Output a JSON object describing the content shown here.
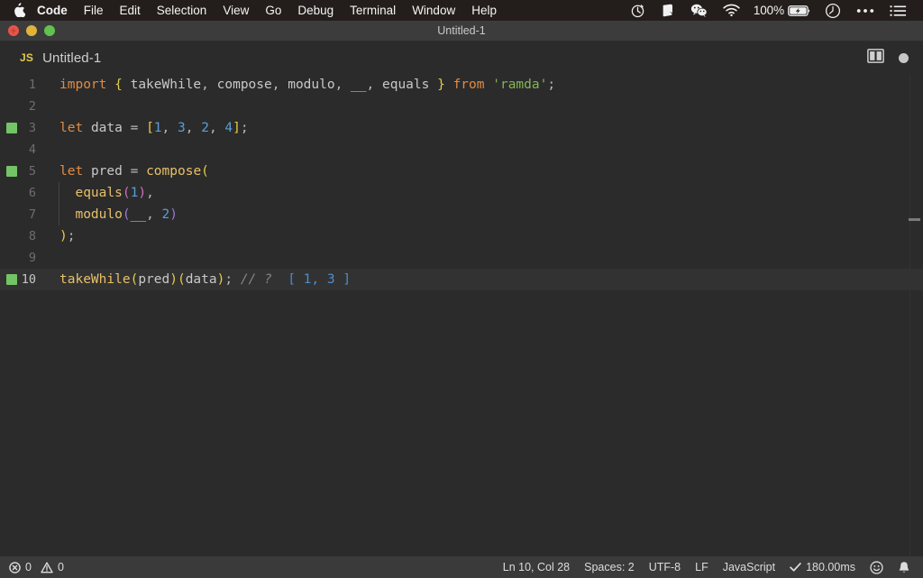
{
  "menubar": {
    "apple_icon": "apple-logo-icon",
    "items": [
      {
        "label": "Code",
        "bold": true
      },
      {
        "label": "File",
        "bold": false
      },
      {
        "label": "Edit",
        "bold": false
      },
      {
        "label": "Selection",
        "bold": false
      },
      {
        "label": "View",
        "bold": false
      },
      {
        "label": "Go",
        "bold": false
      },
      {
        "label": "Debug",
        "bold": false
      },
      {
        "label": "Terminal",
        "bold": false
      },
      {
        "label": "Window",
        "bold": false
      },
      {
        "label": "Help",
        "bold": false
      }
    ],
    "status_icons": [
      "timer-icon",
      "shape-icon",
      "wechat-icon",
      "wifi-icon"
    ],
    "battery_percent": "100%",
    "battery_icon": "battery-charging-icon",
    "trailing_icons": [
      "clock-icon",
      "control-center-icon",
      "list-menu-icon"
    ]
  },
  "window": {
    "title": "Untitled-1",
    "traffic_lights": [
      "close-button",
      "minimize-button",
      "zoom-button"
    ]
  },
  "tabbar": {
    "file_type_badge": "JS",
    "tab_label": "Untitled-1",
    "split_editor_icon": "split-editor-icon",
    "unsaved_indicator": "unsaved-dot-icon"
  },
  "editor": {
    "lines": [
      {
        "number": "1",
        "marker": false,
        "active": false,
        "indent_guide": false,
        "tokens": [
          {
            "text": "import",
            "cls": "t-kw"
          },
          {
            "text": " ",
            "cls": "t-punc"
          },
          {
            "text": "{",
            "cls": "t-brace"
          },
          {
            "text": " takeWhile",
            "cls": "t-id"
          },
          {
            "text": ",",
            "cls": "t-punc"
          },
          {
            "text": " compose",
            "cls": "t-id"
          },
          {
            "text": ",",
            "cls": "t-punc"
          },
          {
            "text": " modulo",
            "cls": "t-id"
          },
          {
            "text": ",",
            "cls": "t-punc"
          },
          {
            "text": " __",
            "cls": "t-id"
          },
          {
            "text": ",",
            "cls": "t-punc"
          },
          {
            "text": " equals ",
            "cls": "t-id"
          },
          {
            "text": "}",
            "cls": "t-brace"
          },
          {
            "text": " ",
            "cls": "t-punc"
          },
          {
            "text": "from",
            "cls": "t-kw"
          },
          {
            "text": " ",
            "cls": "t-punc"
          },
          {
            "text": "'ramda'",
            "cls": "t-str"
          },
          {
            "text": ";",
            "cls": "t-punc"
          }
        ]
      },
      {
        "number": "2",
        "marker": false,
        "active": false,
        "indent_guide": false,
        "tokens": []
      },
      {
        "number": "3",
        "marker": true,
        "active": false,
        "indent_guide": false,
        "tokens": [
          {
            "text": "let",
            "cls": "t-kw"
          },
          {
            "text": " ",
            "cls": "t-punc"
          },
          {
            "text": "data",
            "cls": "t-id"
          },
          {
            "text": " = ",
            "cls": "t-punc"
          },
          {
            "text": "[",
            "cls": "t-brace"
          },
          {
            "text": "1",
            "cls": "t-num"
          },
          {
            "text": ", ",
            "cls": "t-punc"
          },
          {
            "text": "3",
            "cls": "t-num"
          },
          {
            "text": ", ",
            "cls": "t-punc"
          },
          {
            "text": "2",
            "cls": "t-num"
          },
          {
            "text": ", ",
            "cls": "t-punc"
          },
          {
            "text": "4",
            "cls": "t-num"
          },
          {
            "text": "]",
            "cls": "t-brace"
          },
          {
            "text": ";",
            "cls": "t-punc"
          }
        ]
      },
      {
        "number": "4",
        "marker": false,
        "active": false,
        "indent_guide": false,
        "tokens": []
      },
      {
        "number": "5",
        "marker": true,
        "active": false,
        "indent_guide": false,
        "tokens": [
          {
            "text": "let",
            "cls": "t-kw"
          },
          {
            "text": " ",
            "cls": "t-punc"
          },
          {
            "text": "pred",
            "cls": "t-id"
          },
          {
            "text": " = ",
            "cls": "t-punc"
          },
          {
            "text": "compose",
            "cls": "t-fn"
          },
          {
            "text": "(",
            "cls": "t-brace"
          }
        ]
      },
      {
        "number": "6",
        "marker": false,
        "active": false,
        "indent_guide": true,
        "tokens": [
          {
            "text": "  ",
            "cls": "t-punc"
          },
          {
            "text": "equals",
            "cls": "t-fn"
          },
          {
            "text": "(",
            "cls": "t-paren-m"
          },
          {
            "text": "1",
            "cls": "t-num"
          },
          {
            "text": ")",
            "cls": "t-paren-m"
          },
          {
            "text": ",",
            "cls": "t-punc"
          }
        ]
      },
      {
        "number": "7",
        "marker": false,
        "active": false,
        "indent_guide": true,
        "tokens": [
          {
            "text": "  ",
            "cls": "t-punc"
          },
          {
            "text": "modulo",
            "cls": "t-fn"
          },
          {
            "text": "(",
            "cls": "t-paren-p"
          },
          {
            "text": "__",
            "cls": "t-id"
          },
          {
            "text": ", ",
            "cls": "t-punc"
          },
          {
            "text": "2",
            "cls": "t-num"
          },
          {
            "text": ")",
            "cls": "t-paren-p"
          }
        ]
      },
      {
        "number": "8",
        "marker": false,
        "active": false,
        "indent_guide": false,
        "tokens": [
          {
            "text": ")",
            "cls": "t-brace"
          },
          {
            "text": ";",
            "cls": "t-punc"
          }
        ]
      },
      {
        "number": "9",
        "marker": false,
        "active": false,
        "indent_guide": false,
        "tokens": []
      },
      {
        "number": "10",
        "marker": true,
        "active": true,
        "indent_guide": false,
        "tokens": [
          {
            "text": "takeWhile",
            "cls": "t-fn"
          },
          {
            "text": "(",
            "cls": "t-brace"
          },
          {
            "text": "pred",
            "cls": "t-id"
          },
          {
            "text": ")",
            "cls": "t-brace"
          },
          {
            "text": "(",
            "cls": "t-brace"
          },
          {
            "text": "data",
            "cls": "t-id"
          },
          {
            "text": ")",
            "cls": "t-brace"
          },
          {
            "text": ";",
            "cls": "t-punc"
          },
          {
            "text": " // ?",
            "cls": "t-cmt"
          },
          {
            "text": "  [ 1, 3 ]",
            "cls": "t-res"
          }
        ]
      }
    ]
  },
  "statusbar": {
    "error_icon": "error-circle-icon",
    "error_count": "0",
    "warning_icon": "warning-triangle-icon",
    "warning_count": "0",
    "cursor_position": "Ln 10, Col 28",
    "indentation": "Spaces: 2",
    "encoding": "UTF-8",
    "line_ending": "LF",
    "language_mode": "JavaScript",
    "run_time": "180.00ms",
    "check_icon": "checkmark-icon",
    "feedback_icon": "smiley-icon",
    "notifications_icon": "bell-icon"
  },
  "colors": {
    "menubar_bg": "#231e1c",
    "titlebar_bg": "#3c3c3c",
    "editor_bg": "#2b2b2b",
    "active_line_bg": "#323232",
    "statusbar_bg": "#3a3a3a",
    "marker_green": "#73c464",
    "js_yellow": "#e2c84f"
  }
}
